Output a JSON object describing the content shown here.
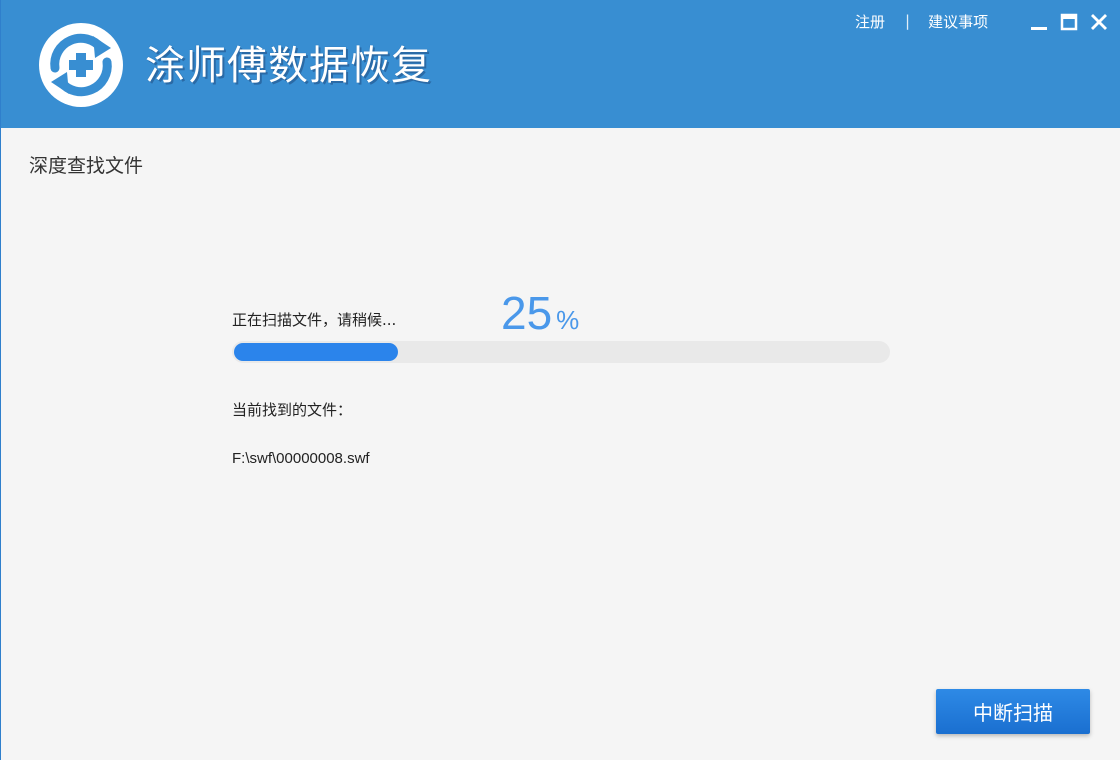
{
  "app": {
    "title": "涂师傅数据恢复",
    "brand_color": "#388ed2",
    "logo_icon": "refresh-plus-icon"
  },
  "top_links": {
    "register": "注册",
    "separator": "|",
    "feedback": "建议事项"
  },
  "window_controls": {
    "minimize_icon": "minimize-icon",
    "maximize_icon": "maximize-icon",
    "close_icon": "close-icon"
  },
  "page": {
    "section_title": "深度查找文件"
  },
  "scan": {
    "status_label": "正在扫描文件，请稍候...",
    "progress_percent": 25,
    "percent_sign": "%",
    "progress_color": "#2b84eb",
    "found_label": "当前找到的文件：",
    "current_file": "F:\\swf\\00000008.swf"
  },
  "actions": {
    "stop_label": "中断扫描"
  }
}
